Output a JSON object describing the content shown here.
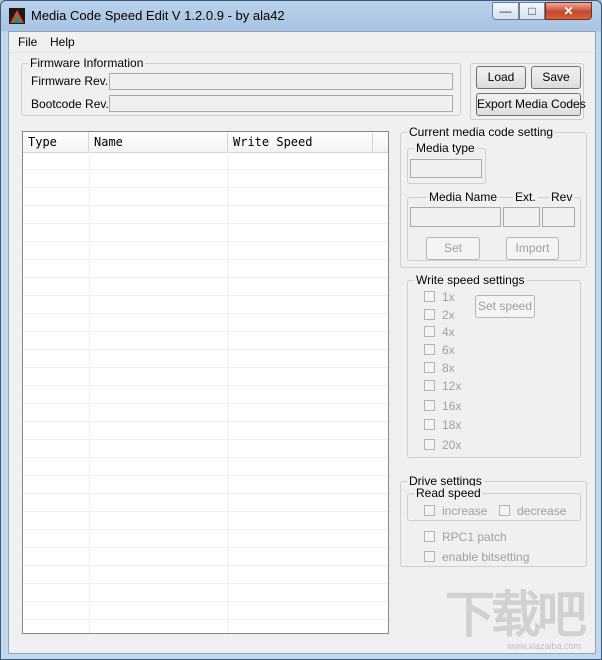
{
  "window": {
    "title": "Media Code Speed Edit V 1.2.0.9 - by ala42",
    "minimize": "—",
    "maximize": "□",
    "close": "✕"
  },
  "menu": [
    "File",
    "Help"
  ],
  "firmware": {
    "legend": "Firmware Information",
    "firmware_rev_label": "Firmware Rev.",
    "bootcode_rev_label": "Bootcode Rev.",
    "firmware_rev_value": "",
    "bootcode_rev_value": ""
  },
  "buttons": {
    "load": "Load",
    "save": "Save",
    "export": "Export Media Codes"
  },
  "table": {
    "columns": [
      "Type",
      "Name",
      "Write Speed"
    ],
    "rows": []
  },
  "current_media": {
    "legend": "Current media code setting",
    "media_type_legend": "Media type",
    "media_name_label": "Media Name",
    "ext_label": "Ext.",
    "rev_label": "Rev",
    "set_button": "Set",
    "import_button": "Import"
  },
  "write_speed": {
    "legend": "Write speed settings",
    "speeds": [
      "1x",
      "2x",
      "4x",
      "6x",
      "8x",
      "12x",
      "16x",
      "18x",
      "20x"
    ],
    "set_speed_button": "Set speed"
  },
  "drive": {
    "legend": "Drive settings",
    "read_speed_legend": "Read speed",
    "increase": "increase",
    "decrease": "decrease",
    "rpc1": "RPC1 patch",
    "bitsetting": "enable bitsetting"
  },
  "watermark": {
    "main": "下载吧",
    "sub": "www.xiazaiba.com"
  },
  "colors": {
    "titlebar": "#b9d1ea",
    "close": "#c7462d",
    "face": "#f0f0f0"
  }
}
